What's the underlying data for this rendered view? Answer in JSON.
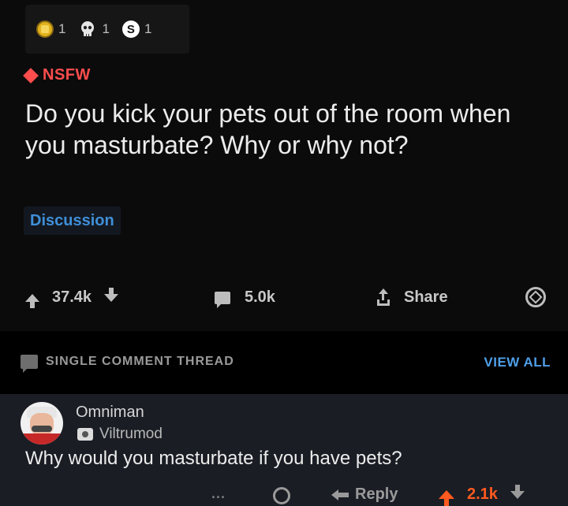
{
  "awards": [
    {
      "icon": "gold-medal-icon",
      "count": "1"
    },
    {
      "icon": "skull-award-icon",
      "count": "1"
    },
    {
      "icon": "s-coin-icon",
      "count": "1"
    }
  ],
  "post": {
    "nsfw_label": "NSFW",
    "title": "Do you kick your pets out of the room when you masturbate? Why or why not?",
    "flair": "Discussion",
    "upvotes": "37.4k",
    "comments": "5.0k",
    "share_label": "Share"
  },
  "thread": {
    "label": "SINGLE COMMENT THREAD",
    "view_all": "VIEW ALL"
  },
  "comment": {
    "username": "Omniman",
    "user_flair": "Viltrumod",
    "text": "Why would you masturbate if you have pets?",
    "more": "...",
    "reply_label": "Reply",
    "score": "2.1k"
  },
  "colors": {
    "nsfw": "#ff4d4d",
    "flair": "#3f8fd8",
    "view_all": "#4f9fe8",
    "upvoted": "#ff5a1f"
  }
}
